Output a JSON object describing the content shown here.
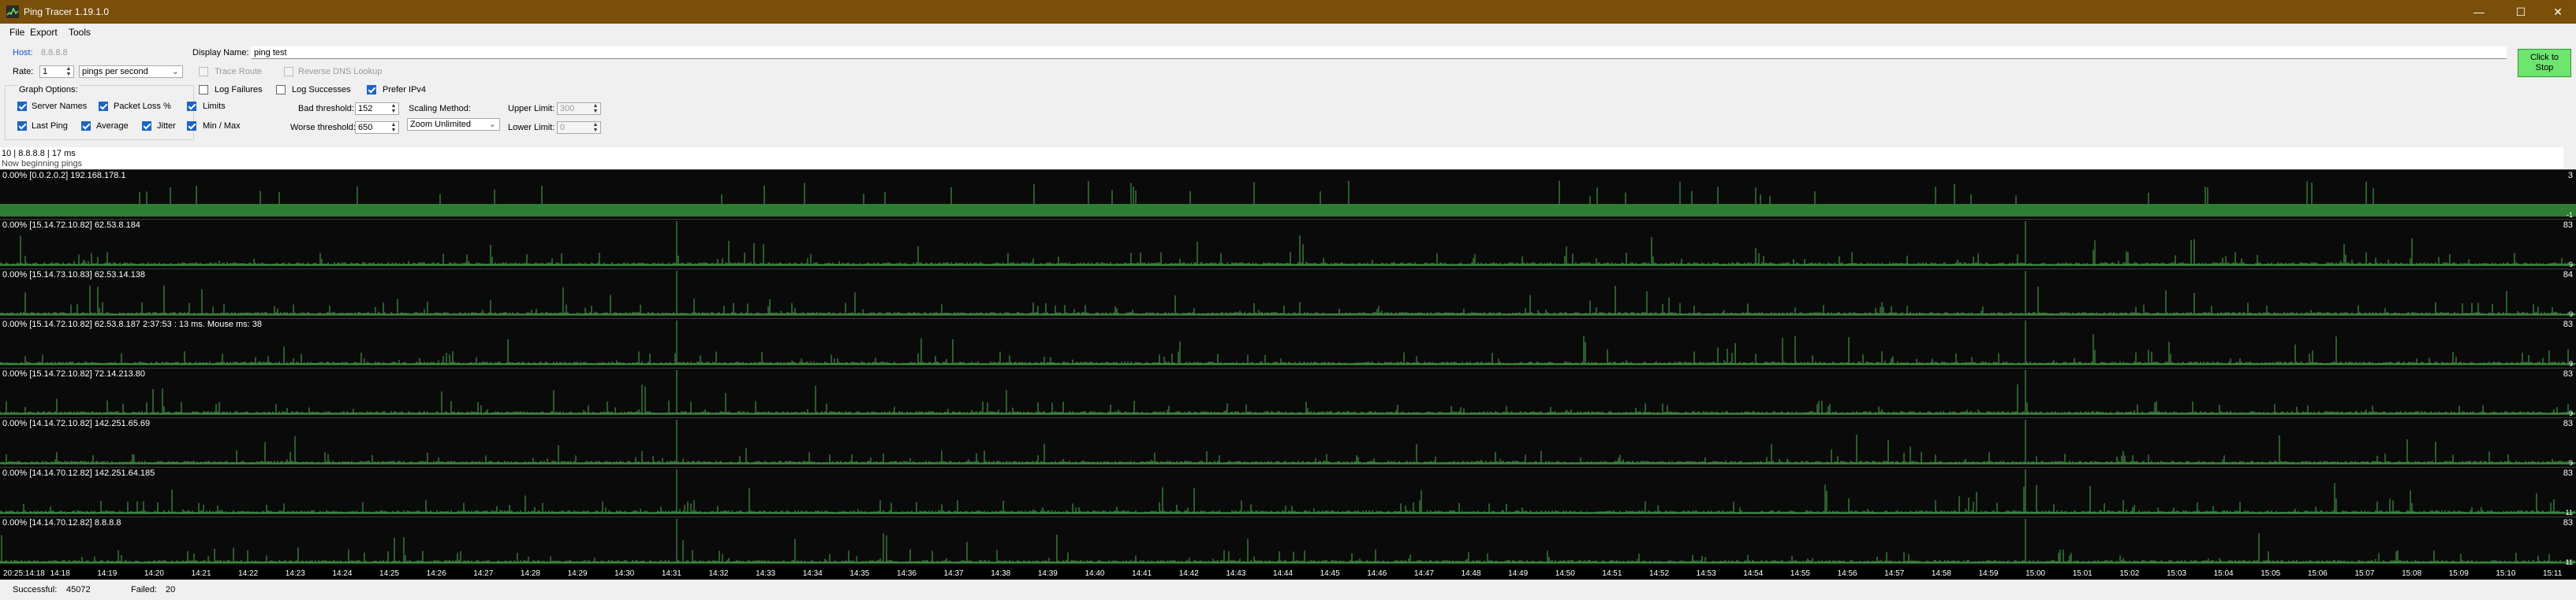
{
  "window": {
    "title": "Ping Tracer 1.19.1.0",
    "min_glyph": "—",
    "max_glyph": "☐",
    "close_glyph": "✕"
  },
  "menu": [
    "File",
    "Export",
    "Tools"
  ],
  "form": {
    "host_label": "Host:",
    "host_value": "8.8.8.8",
    "display_name_label": "Display Name:",
    "display_name_value": "ping test",
    "rate_label": "Rate:",
    "rate_value": "1",
    "rate_unit": "pings per second",
    "trace_route": "Trace Route",
    "reverse_dns": "Reverse DNS Lookup",
    "graph_options": "Graph Options:",
    "log_failures": "Log Failures",
    "log_successes": "Log Successes",
    "prefer_ipv4": "Prefer IPv4",
    "server_names": "Server Names",
    "packet_loss": "Packet Loss %",
    "limits": "Limits",
    "last_ping": "Last Ping",
    "average": "Average",
    "jitter": "Jitter",
    "min_max": "Min / Max",
    "bad_threshold_label": "Bad threshold:",
    "bad_threshold_value": "152",
    "worse_threshold_label": "Worse threshold:",
    "worse_threshold_value": "650",
    "scaling_method_label": "Scaling Method:",
    "scaling_method_value": "Zoom Unlimited",
    "upper_limit_label": "Upper Limit:",
    "upper_limit_value": "300",
    "lower_limit_label": "Lower Limit:",
    "lower_limit_value": "0",
    "stop_button_line1": "Click to",
    "stop_button_line2": "Stop"
  },
  "summary": {
    "line1": "10 | 8.8.8.8 | 17 ms",
    "line2": "Now beginning pings"
  },
  "graphs": [
    {
      "header": "0.00% [0.0.2.0.2] 192.168.178.1",
      "ymax": "3",
      "ymin": "-1",
      "style": "lan"
    },
    {
      "header": "0.00% [15.14.72.10.82] 62.53.8.184",
      "ymax": "83",
      "ymin": "9",
      "style": "wan"
    },
    {
      "header": "0.00% [15.14.73.10.83] 62.53.14.138",
      "ymax": "84",
      "ymin": "9",
      "style": "wan"
    },
    {
      "header": "0.00% [15.14.72.10.82] 62.53.8.187 2:37:53 : 13 ms. Mouse ms: 38",
      "ymax": "83",
      "ymin": "9",
      "style": "wan"
    },
    {
      "header": "0.00% [15.14.72.10.82] 72.14.213.80",
      "ymax": "83",
      "ymin": "9",
      "style": "wan"
    },
    {
      "header": "0.00% [14.14.72.10.82] 142.251.65.69",
      "ymax": "83",
      "ymin": "9",
      "style": "wan"
    },
    {
      "header": "0.00% [14.14.70.12.82] 142.251.64.185",
      "ymax": "83",
      "ymin": "11",
      "style": "wan"
    },
    {
      "header": "0.00% [14.14.70.12.82] 8.8.8.8",
      "ymax": "83",
      "ymin": "11",
      "style": "wan"
    }
  ],
  "time_axis": [
    "20:25:14:18",
    "14:18",
    "14:19",
    "14:20",
    "14:21",
    "14:22",
    "14:23",
    "14:24",
    "14:25",
    "14:26",
    "14:27",
    "14:28",
    "14:29",
    "14:30",
    "14:31",
    "14:32",
    "14:33",
    "14:34",
    "14:35",
    "14:36",
    "14:37",
    "14:38",
    "14:39",
    "14:40",
    "14:41",
    "14:42",
    "14:43",
    "14:44",
    "14:45",
    "14:46",
    "14:47",
    "14:48",
    "14:49",
    "14:50",
    "14:51",
    "14:52",
    "14:53",
    "14:54",
    "14:55",
    "14:56",
    "14:57",
    "14:58",
    "14:59",
    "15:00",
    "15:01",
    "15:02",
    "15:03",
    "15:04",
    "15:05",
    "15:06",
    "15:07",
    "15:08",
    "15:09",
    "15:10",
    "15:11"
  ],
  "status": {
    "successful_label": "Successful:",
    "successful_value": "45072",
    "failed_label": "Failed:",
    "failed_value": "20"
  },
  "colors": {
    "title_bar": "#7a4f0a",
    "graph_bg": "#0a0a0a",
    "ping_line": "#4caf50",
    "stop_button": "#6ee56e"
  }
}
